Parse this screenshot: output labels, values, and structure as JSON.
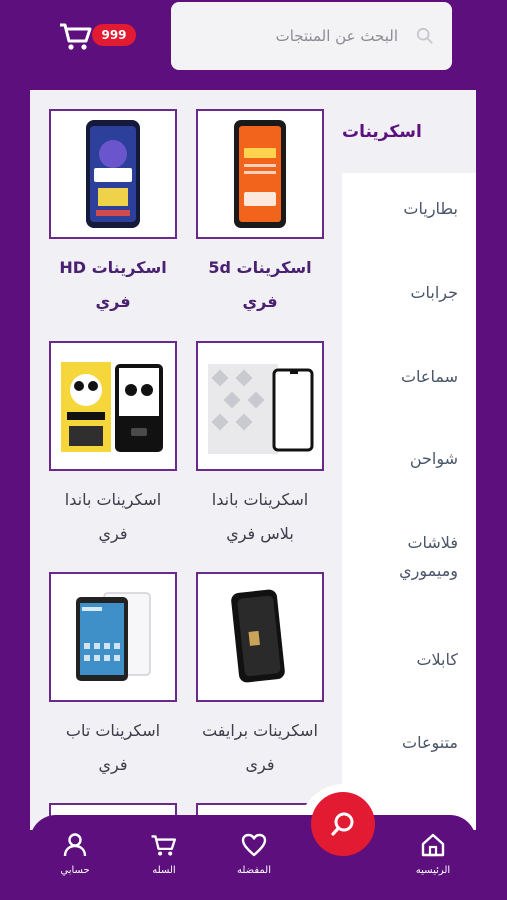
{
  "header": {
    "search_placeholder": "البحث عن المنتجات",
    "cart_badge": "999"
  },
  "categories": {
    "active": "اسكرينات",
    "items": [
      "بطاريات",
      "جرابات",
      "سماعات",
      "شواحن",
      "فلاشات وميموري",
      "كابلات",
      "متنوعات"
    ]
  },
  "products": [
    {
      "name": "اسكرينات 5d فري"
    },
    {
      "name": "اسكرينات HD فري"
    },
    {
      "name": "اسكرينات باندا بلاس فري"
    },
    {
      "name": "اسكرينات باندا فري"
    },
    {
      "name": "اسكرينات برايفت فرى"
    },
    {
      "name": "اسكرينات تاب فري"
    }
  ],
  "bottom_nav": {
    "home": "الرئيسيه",
    "favorites": "المفضله",
    "cart": "السله",
    "account": "حسابي"
  },
  "colors": {
    "brand_purple": "#5c0f7d",
    "accent_red": "#e21b32"
  },
  "icons": [
    "search-icon",
    "cart-icon",
    "home-icon",
    "heart-icon",
    "user-icon"
  ]
}
